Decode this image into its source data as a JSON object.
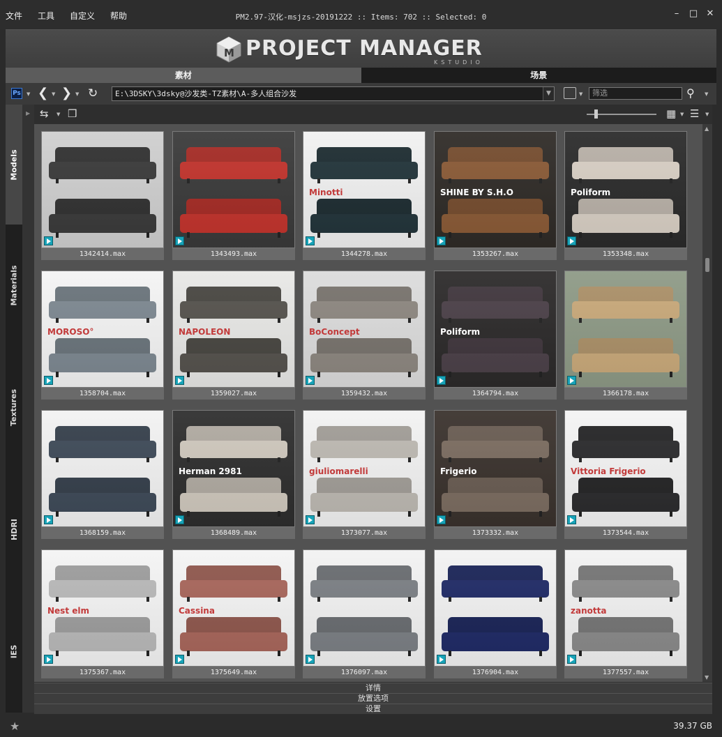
{
  "menu": [
    "文件",
    "工具",
    "自定义",
    "帮助"
  ],
  "window_title": "PM2.97-汉化-msjzs-20191222  :: Items: 702  :: Selected: 0",
  "window_controls": [
    "minimize-icon",
    "maximize-icon",
    "close-icon"
  ],
  "logo": {
    "text": "PROJECT MANAGER",
    "sub": "KSTUDIO"
  },
  "tabs": [
    {
      "label": "素材",
      "active": true
    },
    {
      "label": "场景",
      "active": false
    }
  ],
  "navbar": {
    "ps_label": "Ps",
    "path": "E:\\3DSKY\\3dsky@沙发类-TZ素材\\A-多人组合沙发",
    "filter_placeholder": "筛选"
  },
  "side_tabs": [
    {
      "label": "Models",
      "active": true
    },
    {
      "label": "Materials",
      "active": false
    },
    {
      "label": "Textures",
      "active": false
    },
    {
      "label": "HDRI",
      "active": false
    },
    {
      "label": "IES",
      "active": false
    }
  ],
  "items": [
    {
      "name": "1342414.max",
      "bg": "#cfcfcf",
      "sofa": "#3a3a3a",
      "brand": ""
    },
    {
      "name": "1343493.max",
      "bg": "#3a3a3a",
      "sofa": "#c2332c",
      "brand": ""
    },
    {
      "name": "1344278.max",
      "bg": "#f1f1f1",
      "sofa": "#22343a",
      "brand": "Minotti"
    },
    {
      "name": "1353267.max",
      "bg": "#2f2b27",
      "sofa": "#8a5a36",
      "brand": "SHINE BY S.H.O"
    },
    {
      "name": "1353348.max",
      "bg": "#2b2b2b",
      "sofa": "#d8cfc4",
      "brand": "Poliform"
    },
    {
      "name": "1358704.max",
      "bg": "#f4f4f4",
      "sofa": "#7d8891",
      "brand": "MOROSO°"
    },
    {
      "name": "1359027.max",
      "bg": "#e8e8e6",
      "sofa": "#55524d",
      "brand": "NAPOLEON"
    },
    {
      "name": "1359432.max",
      "bg": "#dcdcdc",
      "sofa": "#8d8780",
      "brand": "BoConcept"
    },
    {
      "name": "1364794.max",
      "bg": "#2c2a2a",
      "sofa": "#4b4048",
      "brand": "Poliform"
    },
    {
      "name": "1366178.max",
      "bg": "#8e9a86",
      "sofa": "#c9a97a",
      "brand": ""
    },
    {
      "name": "1368159.max",
      "bg": "#f2f2f2",
      "sofa": "#3e4a58",
      "brand": ""
    },
    {
      "name": "1368489.max",
      "bg": "#2e2e2e",
      "sofa": "#cfc8bd",
      "brand": "Herman 2981"
    },
    {
      "name": "1373077.max",
      "bg": "#f2f2f2",
      "sofa": "#bdb9b2",
      "brand": "giuliomarelli"
    },
    {
      "name": "1373332.max",
      "bg": "#3a322d",
      "sofa": "#7b6c60",
      "brand": "Frigerio"
    },
    {
      "name": "1373544.max",
      "bg": "#f4f4f4",
      "sofa": "#2b2b2d",
      "brand": "Vittoria Frigerio"
    },
    {
      "name": "1375367.max",
      "bg": "#f4f4f4",
      "sofa": "#b9b9b9",
      "brand": "Nest elm"
    },
    {
      "name": "1375649.max",
      "bg": "#f4f4f4",
      "sofa": "#a8665b",
      "brand": "Cassina"
    },
    {
      "name": "1376097.max",
      "bg": "#f2f2f2",
      "sofa": "#7b7f84",
      "brand": ""
    },
    {
      "name": "1376904.max",
      "bg": "#f2f2f2",
      "sofa": "#1f2a66",
      "brand": ""
    },
    {
      "name": "1377557.max",
      "bg": "#f2f2f2",
      "sofa": "#8a8a8a",
      "brand": "zanotta"
    }
  ],
  "bottom_panels": [
    "详情",
    "放置选项",
    "设置"
  ],
  "status": {
    "disk": "39.37 GB"
  }
}
